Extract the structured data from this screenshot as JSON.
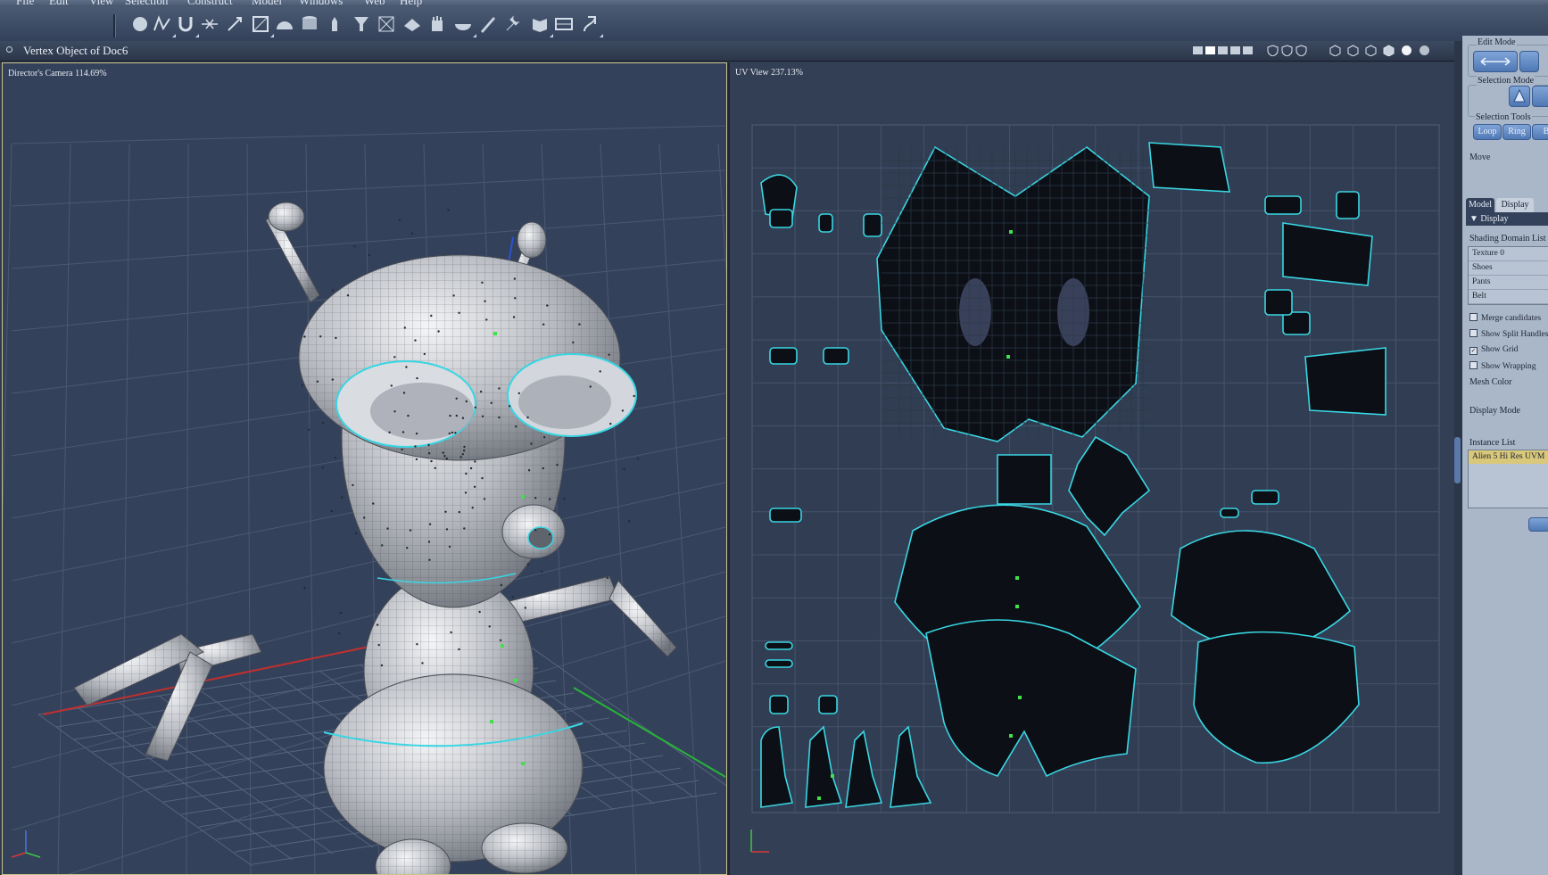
{
  "menu": [
    "File",
    "Edit",
    "View",
    "Selection",
    "Construct",
    "Model",
    "Windows",
    "Web",
    "Help"
  ],
  "toolbar": {
    "tools": [
      "sphere-icon",
      "bezier-icon",
      "magnet-icon",
      "knife-icon",
      "pin-icon",
      "scale-icon",
      "dome-icon",
      "cylinder-icon",
      "hand-icon",
      "funnel-icon",
      "box-icon",
      "plane-icon",
      "glove-icon",
      "bowl-icon",
      "pencil-icon",
      "wrench-icon",
      "fold-icon",
      "frame-icon",
      "bend-icon"
    ]
  },
  "document": {
    "title": "Vertex Object of Doc6"
  },
  "viewports": {
    "left_label": "Director's Camera 114.69%",
    "right_label": "UV View 237.13%"
  },
  "right_panel": {
    "edit_mode": "Edit Mode",
    "selection_mode": "Selection Mode",
    "selection_tools": "Selection Tools",
    "loop": "Loop",
    "ring": "Ring",
    "b": "B",
    "move": "Move",
    "tabs": [
      "Model",
      "Display"
    ],
    "display_header": "Display",
    "shading_domain_list": "Shading Domain List",
    "domains": [
      "Texture 0",
      "Shoes",
      "Pants",
      "Belt"
    ],
    "checkboxes": [
      {
        "label": "Merge candidates",
        "checked": false
      },
      {
        "label": "Show Split Handles",
        "checked": false
      },
      {
        "label": "Show Grid",
        "checked": true
      },
      {
        "label": "Show Wrapping",
        "checked": false
      }
    ],
    "mesh_color": "Mesh Color",
    "display_mode": "Display Mode",
    "instance_list": "Instance List",
    "instance": "Alien 5 Hi Res UVM"
  },
  "colors": {
    "viewport_bg": "#34415a",
    "uv_seam": "#39d6e3",
    "panel_bg": "#a9b7c9",
    "accent": "#4f78b4"
  }
}
